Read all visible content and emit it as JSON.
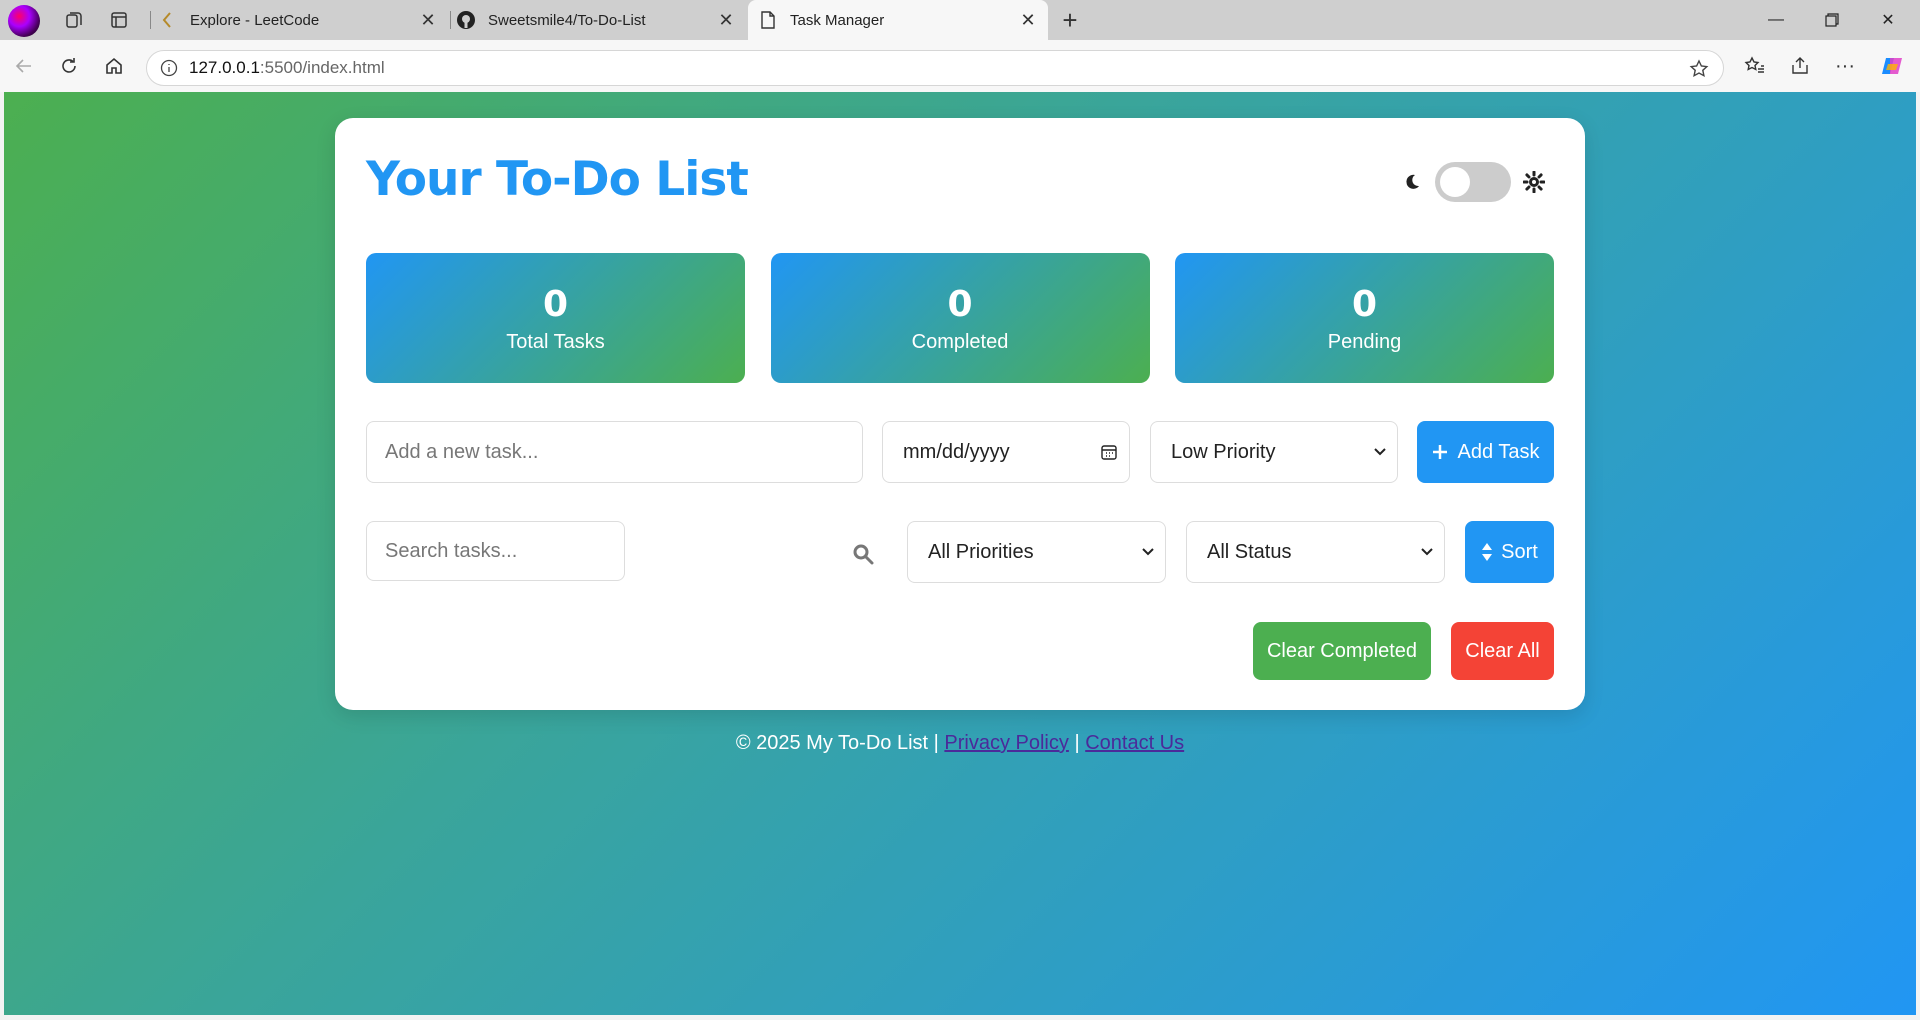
{
  "browser": {
    "tabs": [
      {
        "title": "Explore - LeetCode",
        "icon": "leetcode-icon",
        "active": false
      },
      {
        "title": "Sweetsmile4/To-Do-List",
        "icon": "github-icon",
        "active": false
      },
      {
        "title": "Task Manager",
        "icon": "document-icon",
        "active": true
      }
    ],
    "url_host": "127.0.0.1",
    "url_path": ":5500/index.html"
  },
  "app": {
    "title": "Your To-Do List",
    "stats": [
      {
        "value": "0",
        "label": "Total Tasks"
      },
      {
        "value": "0",
        "label": "Completed"
      },
      {
        "value": "0",
        "label": "Pending"
      }
    ],
    "task_input_placeholder": "Add a new task...",
    "date_placeholder": "mm/dd/yyyy",
    "priority_selected": "Low Priority",
    "add_button": "Add Task",
    "search_placeholder": "Search tasks...",
    "priority_filter_selected": "All Priorities",
    "status_filter_selected": "All Status",
    "sort_button": "Sort",
    "clear_completed_button": "Clear Completed",
    "clear_all_button": "Clear All"
  },
  "footer": {
    "copyright": "© 2025 My To-Do List |",
    "privacy": "Privacy Policy",
    "separator": "|",
    "contact": "Contact Us"
  },
  "colors": {
    "primary": "#2196f3",
    "success": "#4caf50",
    "danger": "#f44336"
  }
}
